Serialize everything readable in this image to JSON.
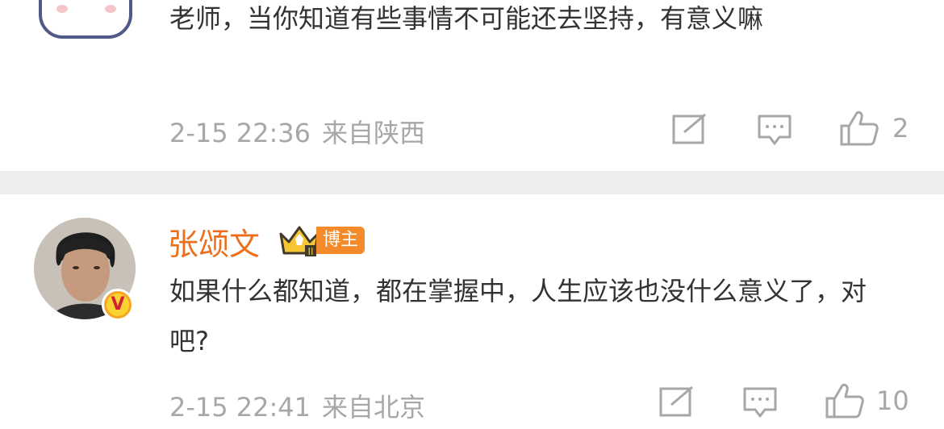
{
  "comments": [
    {
      "text": "老师，当你知道有些事情不可能还去坚持，有意义嘛",
      "time": "2-15 22:36",
      "location": "来自陕西",
      "likes": "2"
    },
    {
      "username": "张颂文",
      "badge": "博主",
      "text": "如果什么都知道，都在掌握中，人生应该也没什么意义了，对吧?",
      "time": "2-15 22:41",
      "location": "来自北京",
      "likes": "10"
    }
  ],
  "icons": [
    "edit-icon",
    "comment-icon",
    "like-icon",
    "crown-icon",
    "verified-v-icon"
  ],
  "colors": {
    "username": "#ec6f1c",
    "meta": "#a7a7a7",
    "separator": "#ededed",
    "text": "#333333",
    "badge": "#f48a2a"
  }
}
